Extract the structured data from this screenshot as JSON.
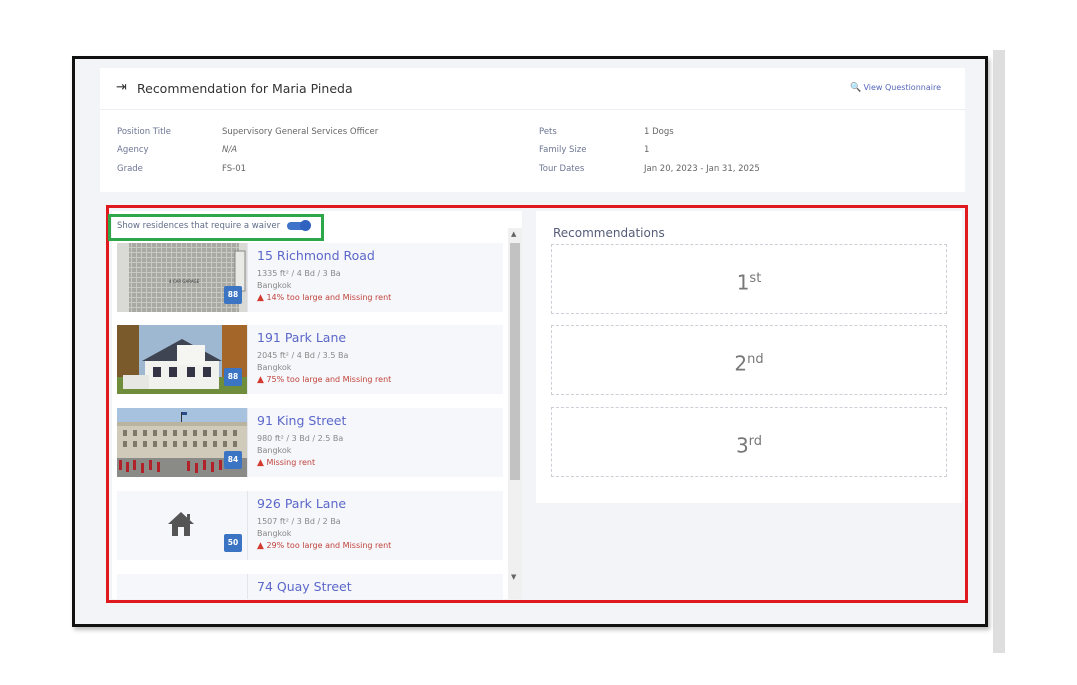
{
  "header": {
    "title": "Recommendation for Maria Pineda",
    "view_questionnaire": "View Questionnaire",
    "fields_left": [
      {
        "label": "Position Title",
        "value": "Supervisory General Services Officer"
      },
      {
        "label": "Agency",
        "value": "N/A"
      },
      {
        "label": "Grade",
        "value": "FS-01"
      }
    ],
    "fields_right": [
      {
        "label": "Pets",
        "value": "1 Dogs"
      },
      {
        "label": "Family Size",
        "value": "1"
      },
      {
        "label": "Tour Dates",
        "value": "Jan 20, 2023 - Jan 31, 2025"
      }
    ]
  },
  "waiver_toggle": {
    "label": "Show residences that require a waiver",
    "on": true
  },
  "residences": [
    {
      "name": "15 Richmond Road",
      "dims": "1335 ft² / 4 Bd / 3 Ba",
      "city": "Bangkok",
      "warning": "14% too large and Missing rent",
      "score": "88",
      "image": "garage-door",
      "garage_text": "4 CAR GARAGE"
    },
    {
      "name": "191 Park Lane",
      "dims": "2045 ft² / 4 Bd / 3.5 Ba",
      "city": "Bangkok",
      "warning": "75% too large and Missing rent",
      "score": "88",
      "image": "house-photo"
    },
    {
      "name": "91 King Street",
      "dims": "980 ft² / 3 Bd / 2.5 Ba",
      "city": "Bangkok",
      "warning": "Missing rent",
      "score": "84",
      "image": "palace-photo"
    },
    {
      "name": "926 Park Lane",
      "dims": "1507 ft² / 3 Bd / 2 Ba",
      "city": "Bangkok",
      "warning": "29% too large and Missing rent",
      "score": "50",
      "image": "home-icon"
    },
    {
      "name": "74 Quay Street"
    }
  ],
  "recommendations": {
    "title": "Recommendations",
    "slots": [
      {
        "num": "1",
        "suffix": "st"
      },
      {
        "num": "2",
        "suffix": "nd"
      },
      {
        "num": "3",
        "suffix": "rd"
      }
    ]
  },
  "colors": {
    "accent": "#5b67c9",
    "warning": "#c0433b",
    "score_badge": "#3a74c2",
    "annotation_red": "#e0191f",
    "annotation_green": "#2ea64a"
  }
}
